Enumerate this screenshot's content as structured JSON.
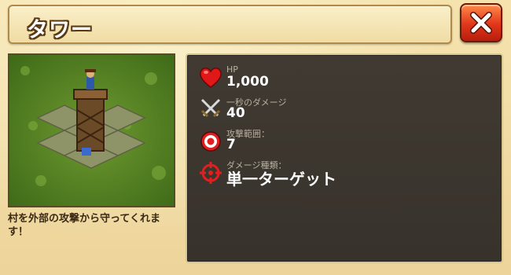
{
  "header": {
    "title": "タワー"
  },
  "description": "村を外部の攻撃から守ってくれます！",
  "stats": {
    "hp": {
      "label": "HP",
      "value": "1,000",
      "icon": "heart-icon"
    },
    "dps": {
      "label": "一秒のダメージ",
      "value": "40",
      "icon": "crossed-swords-icon"
    },
    "range": {
      "label": "攻撃範囲：",
      "value": "7",
      "icon": "target-icon"
    },
    "damage_type": {
      "label": "ダメージ種類：",
      "value": "単一ターゲット",
      "icon": "crosshair-icon"
    }
  },
  "colors": {
    "close_button": "#e0361a",
    "panel_bg": "#3b352e",
    "parchment": "#f0dca4"
  }
}
